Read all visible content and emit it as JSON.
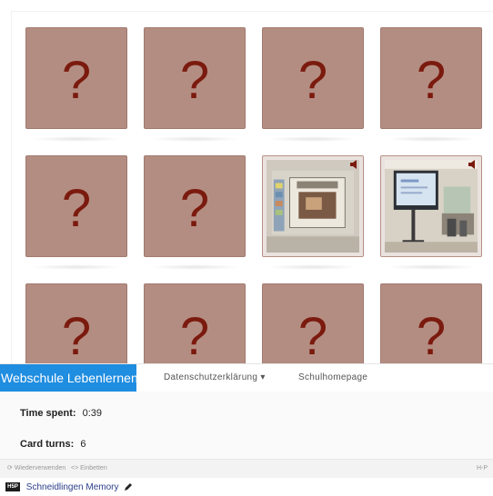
{
  "game": {
    "hidden_symbol": "?",
    "cards": [
      {
        "state": "hidden"
      },
      {
        "state": "hidden"
      },
      {
        "state": "hidden"
      },
      {
        "state": "hidden"
      },
      {
        "state": "hidden"
      },
      {
        "state": "hidden"
      },
      {
        "state": "flipped",
        "image": "presentation-screen-photo"
      },
      {
        "state": "flipped",
        "image": "classroom-whiteboard-photo"
      },
      {
        "state": "hidden"
      },
      {
        "state": "hidden"
      },
      {
        "state": "hidden"
      },
      {
        "state": "hidden"
      }
    ],
    "card_color": "#b48d82",
    "symbol_color": "#7b1a0e"
  },
  "navbar": {
    "brand": "Webschule Lebenlernen",
    "items": [
      {
        "label": "Datenschutzerklärung ▾"
      },
      {
        "label": "Schulhomepage"
      }
    ],
    "brand_color": "#1f8de0"
  },
  "stats": {
    "time_label": "Time spent:",
    "time_value": "0:39",
    "turns_label": "Card turns:",
    "turns_value": "6"
  },
  "footer": {
    "reuse_label": "Wiederverwenden",
    "embed_label": "Einbetten",
    "h5p_label": "H-P"
  },
  "title": {
    "logo": "H5P",
    "text": "Schneidlingen Memory"
  }
}
